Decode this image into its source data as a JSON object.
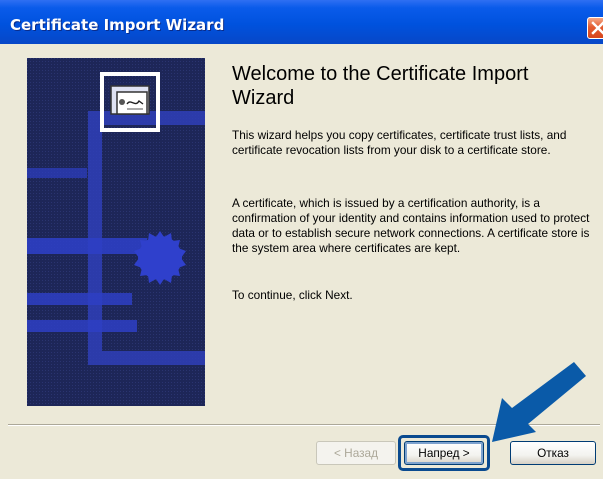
{
  "window": {
    "title": "Certificate Import Wizard"
  },
  "content": {
    "heading": "Welcome to the Certificate Import Wizard",
    "paragraph1": "This wizard helps you copy certificates, certificate trust lists, and certificate revocation lists from your disk to a certificate store.",
    "paragraph2": "A certificate, which is issued by a certification authority, is a confirmation of your identity and contains information used to protect data or to establish secure network connections. A certificate store is the system area where certificates are kept.",
    "paragraph3": "To continue, click Next."
  },
  "buttons": {
    "back": "< Назад",
    "next": "Напред >",
    "cancel": "Отказ"
  },
  "colors": {
    "titlebar": "#0052de",
    "art_background": "#20295c",
    "art_accent": "#2e3fc4",
    "arrow": "#0a5aa8"
  },
  "icons": [
    "close-icon",
    "certificate-icon",
    "pointer-arrow"
  ]
}
